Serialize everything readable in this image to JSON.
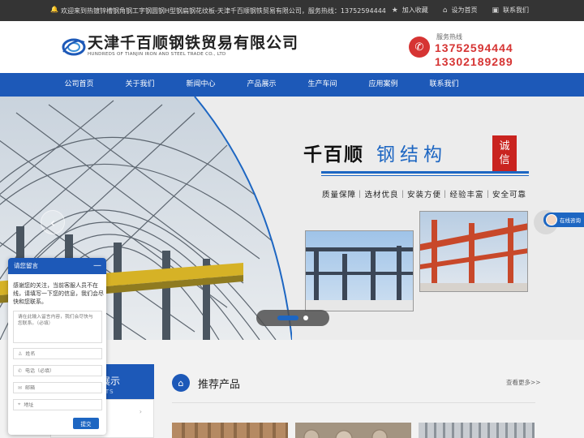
{
  "topbar": {
    "welcome": "欢迎来到热镀锌槽钢角钢工字钢圆钢H型钢扁钢花纹板-天津千百顺钢铁贸易有限公司，服务热线：13752594444",
    "links": [
      {
        "label": "加入收藏",
        "icon": "star-icon"
      },
      {
        "label": "设为首页",
        "icon": "home-icon"
      },
      {
        "label": "联系我们",
        "icon": "contact-icon"
      }
    ]
  },
  "header": {
    "company_cn": "天津千百顺钢铁贸易有限公司",
    "company_en": "HUNDREDS OF TIANJIN IRON AND STEEL TRADE CO., LTD",
    "hotline_label": "服务热线",
    "phone1": "13752594444",
    "phone2": "13302189289"
  },
  "nav": {
    "items": [
      "公司首页",
      "关于我们",
      "新闻中心",
      "产品展示",
      "生产车间",
      "应用案例",
      "联系我们"
    ]
  },
  "banner": {
    "slogan_brand": "千百顺",
    "slogan_main": "钢结构",
    "seal_chars": [
      "诚",
      "信"
    ],
    "features": "质量保障｜选材优良｜安装方便｜经验丰富｜安全可靠"
  },
  "consult": {
    "label": "在线咨询"
  },
  "categories": {
    "title": "展示",
    "subtitle": "CTS"
  },
  "recommended": {
    "title": "推荐产品",
    "more": "查看更多>>"
  },
  "message": {
    "title": "请您留言",
    "minimize": "—",
    "intro": "感谢您的关注，当前客服人员不在线，请填写一下您的信息，我们会尽快和您联系。",
    "textarea_placeholder": "请在此输入留言内容，我们会尽快与您联系。（必填）",
    "fields": [
      {
        "placeholder": "姓名",
        "icon": "user-icon"
      },
      {
        "placeholder": "电话（必填）",
        "icon": "phone-icon"
      },
      {
        "placeholder": "邮箱",
        "icon": "mail-icon"
      },
      {
        "placeholder": "地址",
        "icon": "location-icon"
      }
    ],
    "submit": "提交"
  },
  "colors": {
    "brand_blue": "#1d59b8",
    "accent_red": "#d63433",
    "topbar": "#343434"
  }
}
